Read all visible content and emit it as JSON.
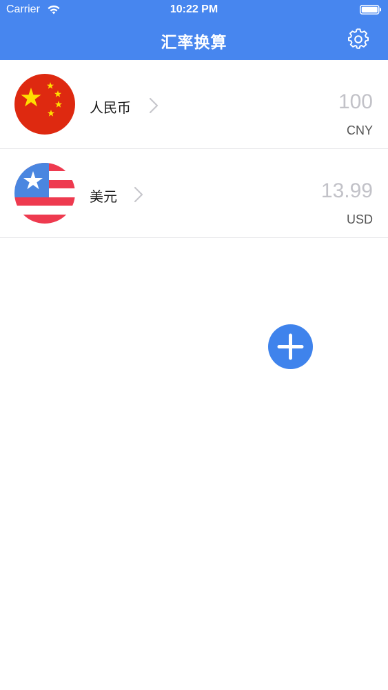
{
  "status_bar": {
    "carrier": "Carrier",
    "time": "10:22 PM"
  },
  "nav": {
    "title": "汇率换算",
    "settings_icon": "gear-icon"
  },
  "currencies": [
    {
      "name": "人民币",
      "amount": "100",
      "code": "CNY",
      "flag_icon": "china-flag-icon"
    },
    {
      "name": "美元",
      "amount": "13.99",
      "code": "USD",
      "flag_icon": "us-flag-icon"
    }
  ],
  "add_button_icon": "plus-icon",
  "colors": {
    "primary": "#4786ef",
    "amount_text": "#c2c2c8",
    "code_text": "#555555",
    "china_red": "#de2910",
    "china_yellow": "#ffde00",
    "us_red": "#ee3a4f",
    "us_blue": "#4a86e0"
  }
}
